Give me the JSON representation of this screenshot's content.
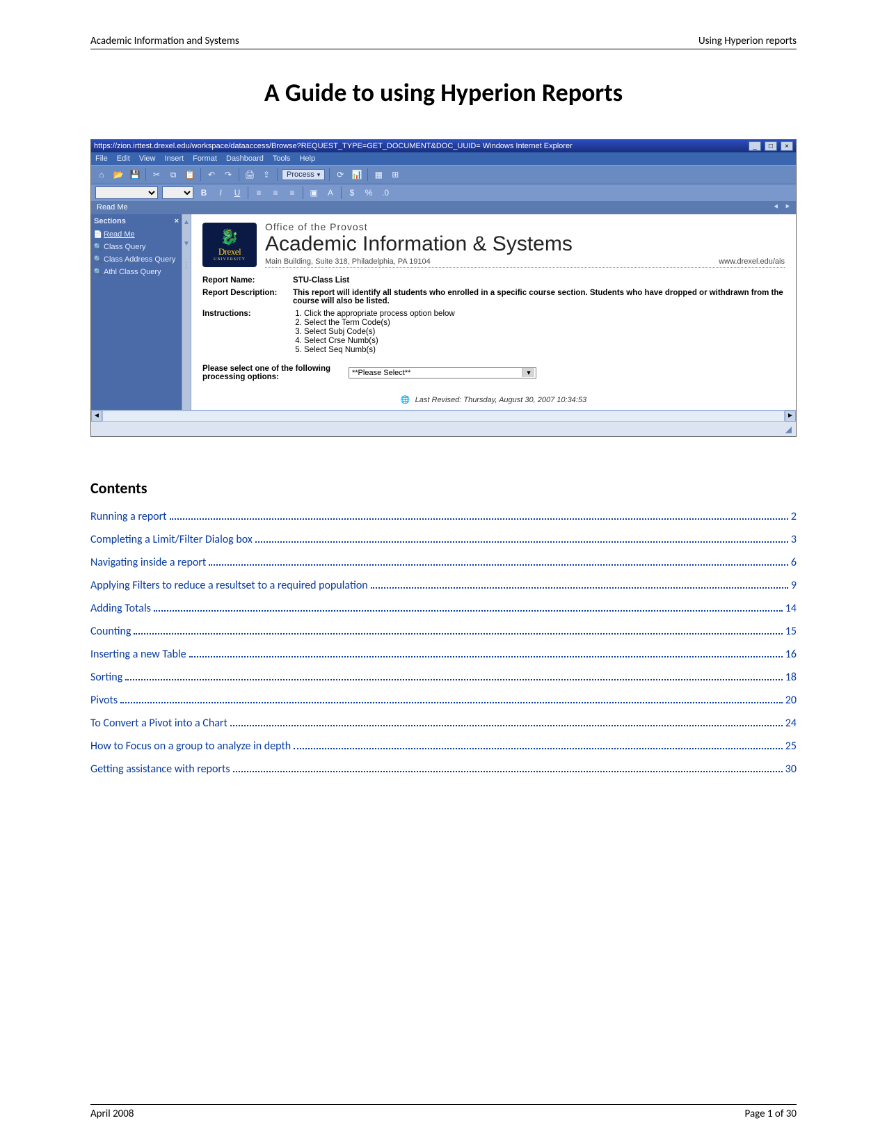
{
  "header": {
    "left": "Academic Information and Systems",
    "right": "Using Hyperion reports"
  },
  "title": "A Guide to using Hyperion Reports",
  "app": {
    "url": "https://zion.irttest.drexel.edu/workspace/dataaccess/Browse?REQUEST_TYPE=GET_DOCUMENT&DOC_UUID=   Windows Internet Explorer",
    "window_controls": {
      "min": "_",
      "max": "□",
      "close": "×"
    },
    "menus": [
      "File",
      "Edit",
      "View",
      "Insert",
      "Format",
      "Dashboard",
      "Tools",
      "Help"
    ],
    "toolbar": {
      "process_label": "Process",
      "font_dropdown_placeholder": "",
      "size_dropdown_placeholder": ""
    },
    "crumb": "Read Me",
    "sidebar": {
      "title": "Sections",
      "items": [
        {
          "icon": "📄",
          "label": "Read Me"
        },
        {
          "icon": "🔍",
          "label": "Class Query"
        },
        {
          "icon": "🔍",
          "label": "Class Address Query"
        },
        {
          "icon": "🔍",
          "label": "Athl Class Query"
        }
      ]
    },
    "banner": {
      "office": "Office of the Provost",
      "title": "Academic Information & Systems",
      "address": "Main Building, Suite 318, Philadelphia, PA 19104",
      "site": "www.drexel.edu/ais",
      "logo_text": "Drexel",
      "logo_sub": "UNIVERSITY"
    },
    "report": {
      "name_label": "Report Name:",
      "name": "STU-Class List",
      "desc_label": "Report Description:",
      "desc": "This report will identify all students who enrolled in a specific course section. Students who have dropped or withdrawn from the course will also be listed.",
      "instr_label": "Instructions:",
      "instructions": [
        "Click the appropriate process option below",
        "Select the Term Code(s)",
        "Select Subj Code(s)",
        "Select Crse Numb(s)",
        "Select Seq Numb(s)"
      ],
      "process_label": "Please select one of the following processing options:",
      "process_selected": "**Please Select**",
      "last_revised": "Last Revised: Thursday, August 30, 2007 10:34:53"
    }
  },
  "contents_heading": "Contents",
  "toc": [
    {
      "label": "Running a report",
      "page": "2"
    },
    {
      "label": "Completing a Limit/Filter Dialog box",
      "page": "3"
    },
    {
      "label": "Navigating inside a report",
      "page": "6"
    },
    {
      "label": "Applying Filters to reduce a resultset to a required population",
      "page": "9"
    },
    {
      "label": "Adding Totals",
      "page": "14"
    },
    {
      "label": "Counting",
      "page": "15"
    },
    {
      "label": "Inserting a new Table",
      "page": "16"
    },
    {
      "label": "Sorting",
      "page": "18"
    },
    {
      "label": "Pivots",
      "page": "20"
    },
    {
      "label": "To Convert a Pivot into a Chart",
      "page": "24"
    },
    {
      "label": "How to Focus on a group to analyze in depth",
      "page": "25"
    },
    {
      "label": "Getting assistance with reports",
      "page": "30"
    }
  ],
  "footer": {
    "left": "April 2008",
    "right": "Page 1 of 30"
  }
}
